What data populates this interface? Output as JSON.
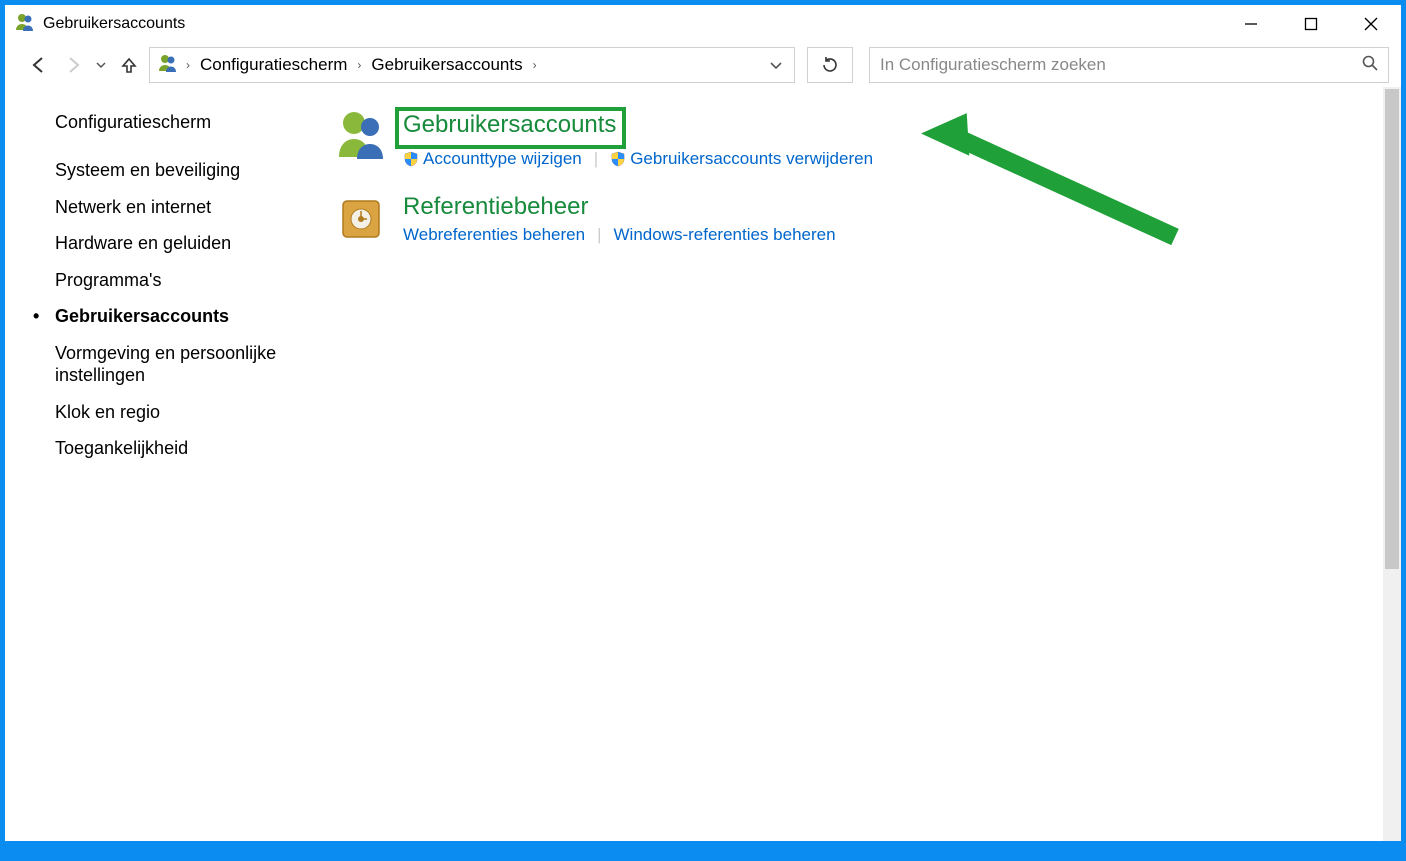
{
  "title": "Gebruikersaccounts",
  "window_controls": {
    "min": "minimize",
    "max": "maximize",
    "close": "close"
  },
  "breadcrumb": {
    "items": [
      "Configuratiescherm",
      "Gebruikersaccounts"
    ]
  },
  "search": {
    "placeholder": "In Configuratiescherm zoeken"
  },
  "sidebar": {
    "home": "Configuratiescherm",
    "items": [
      {
        "label": "Systeem en beveiliging",
        "active": false
      },
      {
        "label": "Netwerk en internet",
        "active": false
      },
      {
        "label": "Hardware en geluiden",
        "active": false
      },
      {
        "label": "Programma's",
        "active": false
      },
      {
        "label": "Gebruikersaccounts",
        "active": true
      },
      {
        "label": "Vormgeving en persoonlijke instellingen",
        "active": false
      },
      {
        "label": "Klok en regio",
        "active": false
      },
      {
        "label": "Toegankelijkheid",
        "active": false
      }
    ]
  },
  "main": {
    "categories": [
      {
        "title": "Gebruikersaccounts",
        "highlighted": true,
        "sublinks": [
          {
            "label": "Accounttype wijzigen",
            "shield": true
          },
          {
            "label": "Gebruikersaccounts verwijderen",
            "shield": true
          }
        ]
      },
      {
        "title": "Referentiebeheer",
        "highlighted": false,
        "sublinks": [
          {
            "label": "Webreferenties beheren",
            "shield": false
          },
          {
            "label": "Windows-referenties beheren",
            "shield": false
          }
        ]
      }
    ]
  },
  "annotation": {
    "type": "arrow-highlight",
    "points_to": "Gebruikersaccounts"
  }
}
